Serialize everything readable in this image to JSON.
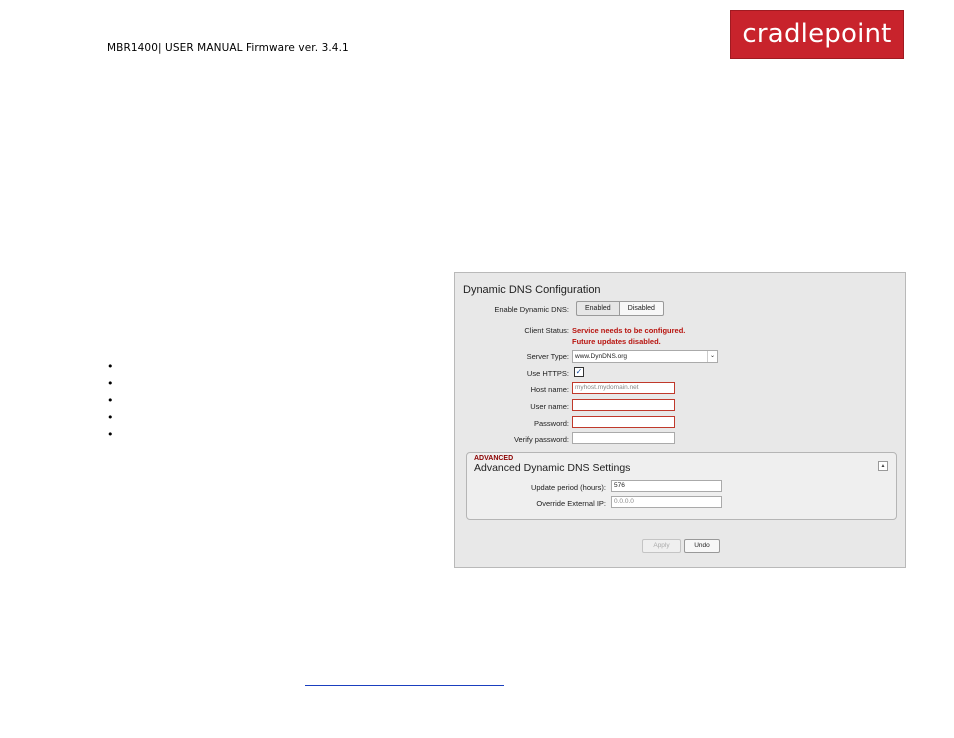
{
  "header": {
    "manual_title": "MBR1400| USER MANUAL Firmware ver. 3.4.1",
    "logo_text": "cradlepoint"
  },
  "bullets_count": 5,
  "form": {
    "title": "Dynamic DNS Configuration",
    "enable_label": "Enable Dynamic DNS:",
    "enabled_btn": "Enabled",
    "disabled_btn": "Disabled",
    "client_status_label": "Client Status:",
    "client_status_line1": "Service needs to be configured.",
    "client_status_line2": "Future updates disabled.",
    "server_type_label": "Server Type:",
    "server_type_value": "www.DynDNS.org",
    "use_https_label": "Use HTTPS:",
    "use_https_checked": true,
    "host_name_label": "Host name:",
    "host_name_placeholder": "myhost.mydomain.net",
    "user_name_label": "User name:",
    "password_label": "Password:",
    "verify_password_label": "Verify password:"
  },
  "advanced": {
    "tag": "ADVANCED",
    "title": "Advanced Dynamic DNS Settings",
    "update_period_label": "Update period (hours):",
    "update_period_value": "576",
    "override_ip_label": "Override External IP:",
    "override_ip_placeholder": "0.0.0.0"
  },
  "buttons": {
    "apply": "Apply",
    "undo": "Undo"
  },
  "colors": {
    "brand": "#c8232c",
    "error": "#b8140f"
  }
}
